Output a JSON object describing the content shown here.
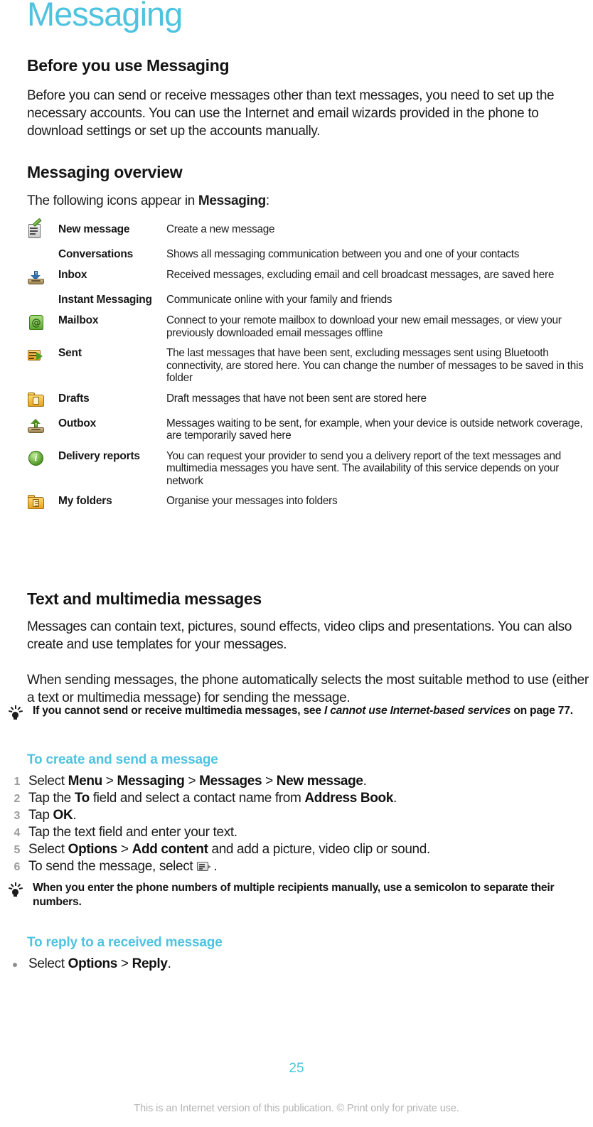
{
  "document": {
    "title": "Messaging",
    "page_number": "25",
    "footer_note": "This is an Internet version of this publication. © Print only for private use."
  },
  "sections": {
    "before": {
      "heading": "Before you use Messaging",
      "paragraph": "Before you can send or receive messages other than text messages, you need to set up the necessary accounts. You can use the Internet and email wizards provided in the phone to download settings or set up the accounts manually."
    },
    "overview": {
      "heading": "Messaging overview",
      "intro_prefix": "The following icons appear in ",
      "intro_bold": "Messaging",
      "intro_suffix": ":",
      "rows": [
        {
          "icon": "new-message-icon",
          "label": "New message",
          "description": "Create a new message"
        },
        {
          "icon": "none",
          "label": "Conversations",
          "description": "Shows all messaging communication between you and one of your contacts"
        },
        {
          "icon": "inbox-icon",
          "label": "Inbox",
          "description": "Received messages, excluding email and cell broadcast messages, are saved here"
        },
        {
          "icon": "none",
          "label": "Instant Messaging",
          "description": "Communicate online with your family and friends"
        },
        {
          "icon": "mailbox-icon",
          "label": "Mailbox",
          "description": "Connect to your remote mailbox to download your new email messages, or view your previously downloaded email messages offline"
        },
        {
          "icon": "sent-icon",
          "label": "Sent",
          "description": "The last messages that have been sent, excluding messages sent using Bluetooth connectivity, are stored here. You can change the number of messages to be saved in this folder"
        },
        {
          "icon": "drafts-icon",
          "label": "Drafts",
          "description": "Draft messages that have not been sent are stored here"
        },
        {
          "icon": "outbox-icon",
          "label": "Outbox",
          "description": "Messages waiting to be sent, for example, when your device is outside network coverage, are temporarily saved here"
        },
        {
          "icon": "delivery-reports-icon",
          "label": "Delivery reports",
          "description": "You can request your provider to send you a delivery report of the text messages and multimedia messages you have sent. The availability of this service depends on your network"
        },
        {
          "icon": "my-folders-icon",
          "label": "My folders",
          "description": "Organise your messages into folders"
        }
      ]
    },
    "textmm": {
      "heading": "Text and multimedia messages",
      "paragraph1": "Messages can contain text, pictures, sound effects, video clips and presentations. You can also create and use templates for your messages.",
      "paragraph2": "When sending messages, the phone automatically selects the most suitable method to use (either a text or multimedia message) for sending the message.",
      "tip1": {
        "prefix": "If you cannot send or receive multimedia messages, see ",
        "italic": "I cannot use Internet-based services",
        "suffix": " on page 77."
      }
    },
    "create_send": {
      "heading": "To create and send a message",
      "steps": [
        {
          "num": "1",
          "parts": [
            {
              "t": "Select ",
              "b": false
            },
            {
              "t": "Menu",
              "b": true
            },
            {
              "t": " > ",
              "b": false
            },
            {
              "t": "Messaging",
              "b": true
            },
            {
              "t": " > ",
              "b": false
            },
            {
              "t": "Messages",
              "b": true
            },
            {
              "t": " > ",
              "b": false
            },
            {
              "t": "New message",
              "b": true
            },
            {
              "t": ".",
              "b": false
            }
          ]
        },
        {
          "num": "2",
          "parts": [
            {
              "t": "Tap the ",
              "b": false
            },
            {
              "t": "To",
              "b": true
            },
            {
              "t": " field and select a contact name from ",
              "b": false
            },
            {
              "t": "Address Book",
              "b": true
            },
            {
              "t": ".",
              "b": false
            }
          ]
        },
        {
          "num": "3",
          "parts": [
            {
              "t": "Tap ",
              "b": false
            },
            {
              "t": "OK",
              "b": true
            },
            {
              "t": ".",
              "b": false
            }
          ]
        },
        {
          "num": "4",
          "parts": [
            {
              "t": "Tap the text field and enter your text.",
              "b": false
            }
          ]
        },
        {
          "num": "5",
          "parts": [
            {
              "t": "Select ",
              "b": false
            },
            {
              "t": "Options",
              "b": true
            },
            {
              "t": " > ",
              "b": false
            },
            {
              "t": "Add content",
              "b": true
            },
            {
              "t": " and add a picture, video clip or sound.",
              "b": false
            }
          ]
        },
        {
          "num": "6",
          "parts": [
            {
              "t": "To send the message, select ",
              "b": false
            },
            {
              "t": "[send-icon]",
              "b": false
            },
            {
              "t": ".",
              "b": false
            }
          ]
        }
      ],
      "tip2": "When you enter the phone numbers of multiple recipients manually, use a semicolon to separate their numbers."
    },
    "reply": {
      "heading": "To reply to a received message",
      "bullet": {
        "prefix": "Select ",
        "bold1": "Options",
        "middle": " > ",
        "bold2": "Reply",
        "suffix": "."
      }
    }
  },
  "colors": {
    "accent": "#4ec3e0",
    "text": "#1b1b1b",
    "muted": "#b3b3b3",
    "step_number": "#9b9b9b"
  }
}
